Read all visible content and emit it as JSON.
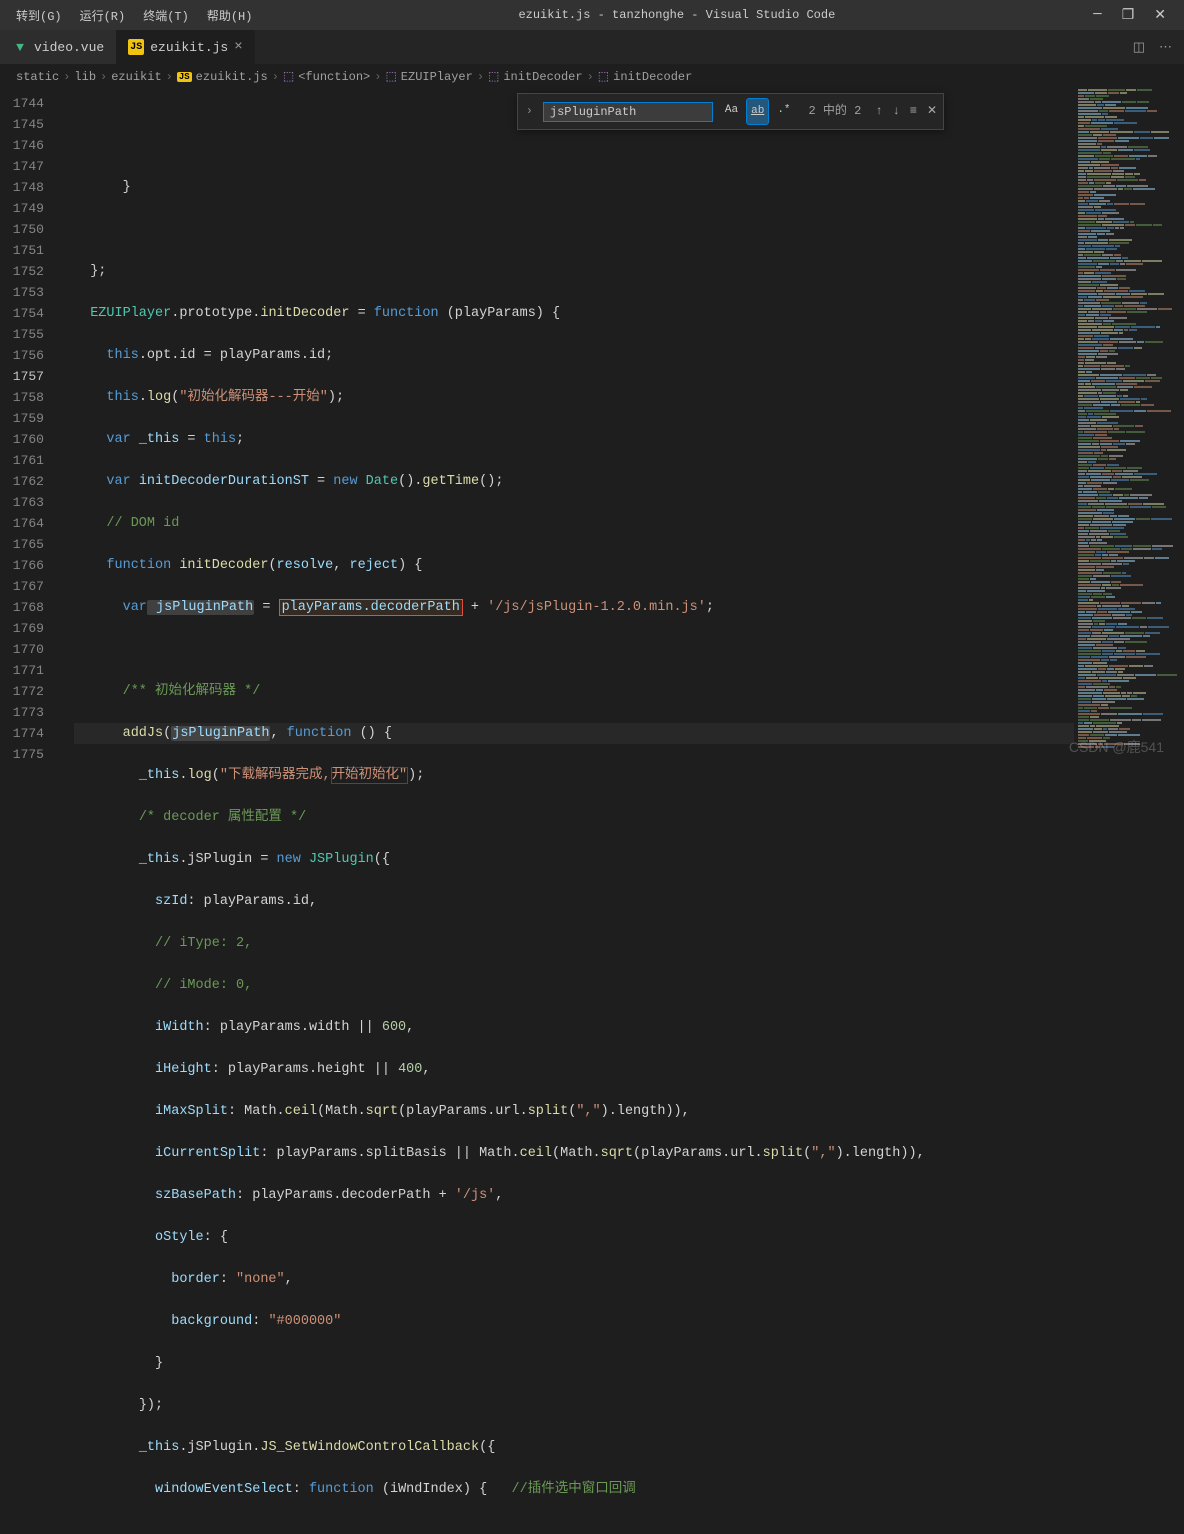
{
  "titlebar": {
    "menu": [
      {
        "label": "转到(G)"
      },
      {
        "label": "运行(R)"
      },
      {
        "label": "终端(T)"
      },
      {
        "label": "帮助(H)"
      }
    ],
    "title": "ezuikit.js - tanzhonghe - Visual Studio Code"
  },
  "tabs": [
    {
      "icon": "vue",
      "label": "video.vue",
      "active": false
    },
    {
      "icon": "js",
      "label": "ezuikit.js",
      "active": true
    }
  ],
  "breadcrumbs": [
    {
      "label": "static",
      "icon": ""
    },
    {
      "label": "lib",
      "icon": ""
    },
    {
      "label": "ezuikit",
      "icon": ""
    },
    {
      "label": "ezuikit.js",
      "icon": "js"
    },
    {
      "label": "<function>",
      "icon": "cube"
    },
    {
      "label": "EZUIPlayer",
      "icon": "cube"
    },
    {
      "label": "initDecoder",
      "icon": "cube"
    },
    {
      "label": "initDecoder",
      "icon": "cube"
    }
  ],
  "find": {
    "value": "jsPluginPath",
    "results": "2 中的 2"
  },
  "lineStart": 1744,
  "lineEnd": 1775,
  "currentLine": 1757,
  "watermark": "CSDN @鹿541",
  "code": {
    "l1744": {
      "indent": "      "
    },
    "l1746": {
      "close": "};"
    },
    "l1747": {
      "class": "EZUIPlayer",
      "proto": ".prototype.",
      "fn": "initDecoder",
      "eq": " = ",
      "kw": "function",
      "params": " (playParams) {"
    },
    "l1748": {
      "this": "this",
      "dot": ".opt.id = playParams.id;"
    },
    "l1749": {
      "this": "this",
      "dot": ".",
      "fn": "log",
      "open": "(",
      "str": "\"初始化解码器---开始\"",
      "close": ");"
    },
    "l1750": {
      "kw": "var",
      "var": " _this",
      "rest": " = ",
      "this": "this",
      "semi": ";"
    },
    "l1751": {
      "kw": "var",
      "var": " initDecoderDurationST",
      "eq": " = ",
      "new": "new",
      "cls": " Date",
      "call": "().",
      "fn": "getTime",
      "rest": "();"
    },
    "l1752": {
      "cmt": "// DOM id"
    },
    "l1753": {
      "kw": "function",
      "fn": " initDecoder",
      "open": "(",
      "p1": "resolve",
      "comma": ", ",
      "p2": "reject",
      "close": ") {"
    },
    "l1754": {
      "kw": "var",
      "var": " jsPluginPath",
      "eq": " = ",
      "boxed": "playParams.decoderPath",
      "plus": " + ",
      "str": "'/js/jsPlugin-1.2.0.min.js'",
      "semi": ";"
    },
    "l1756": {
      "cmt": "/** 初始化解码器 */"
    },
    "l1757": {
      "fn": "addJs",
      "open": "(",
      "hl": "jsPluginPath",
      "comma": ", ",
      "kw": "function",
      "rest": " () {"
    },
    "l1758": {
      "var": "_this",
      "dot": ".",
      "fn": "log",
      "open": "(",
      "str1": "\"下载解码器完成,",
      "str2": "开始初始化\"",
      "close": ");"
    },
    "l1759": {
      "cmt": "/* decoder 属性配置 */"
    },
    "l1760": {
      "var": "_this",
      "dot": ".jSPlugin = ",
      "new": "new",
      "cls": " JSPlugin",
      "rest": "({"
    },
    "l1761": {
      "key": "szId",
      "colon": ": playParams.id,"
    },
    "l1762": {
      "cmt": "// iType: 2,"
    },
    "l1763": {
      "cmt": "// iMode: 0,"
    },
    "l1764": {
      "key": "iWidth",
      "rest": ": playParams.width || ",
      "num": "600",
      "comma": ","
    },
    "l1765": {
      "key": "iHeight",
      "rest": ": playParams.height || ",
      "num": "400",
      "comma": ","
    },
    "l1766": {
      "key": "iMaxSplit",
      "rest": ": Math.",
      "fn1": "ceil",
      "op1": "(Math.",
      "fn2": "sqrt",
      "op2": "(playParams.url.",
      "fn3": "split",
      "op3": "(",
      "str": "\",\"",
      "rest2": ").length)),"
    },
    "l1767": {
      "key": "iCurrentSplit",
      "rest": ": playParams.splitBasis || Math.",
      "fn1": "ceil",
      "op1": "(Math.",
      "fn2": "sqrt",
      "op2": "(playParams.url.",
      "fn3": "split",
      "op3": "(",
      "str": "\",\"",
      "rest2": ").length)),"
    },
    "l1768": {
      "key": "szBasePath",
      "rest": ": playParams.decoderPath + ",
      "str": "'/js'",
      "comma": ","
    },
    "l1769": {
      "key": "oStyle",
      "rest": ": {"
    },
    "l1770": {
      "key": "border",
      "colon": ": ",
      "str": "\"none\"",
      "comma": ","
    },
    "l1771": {
      "key": "background",
      "colon": ": ",
      "str": "\"#000000\""
    },
    "l1772": {
      "close": "}"
    },
    "l1773": {
      "close": "});"
    },
    "l1774": {
      "var": "_this",
      "rest": ".jSPlugin.",
      "fn": "JS_SetWindowControlCallback",
      "rest2": "({"
    },
    "l1775": {
      "key": "windowEventSelect",
      "colon": ": ",
      "kw": "function",
      "params": " (iWndIndex) {   ",
      "cmt": "//插件选中窗口回调"
    }
  }
}
